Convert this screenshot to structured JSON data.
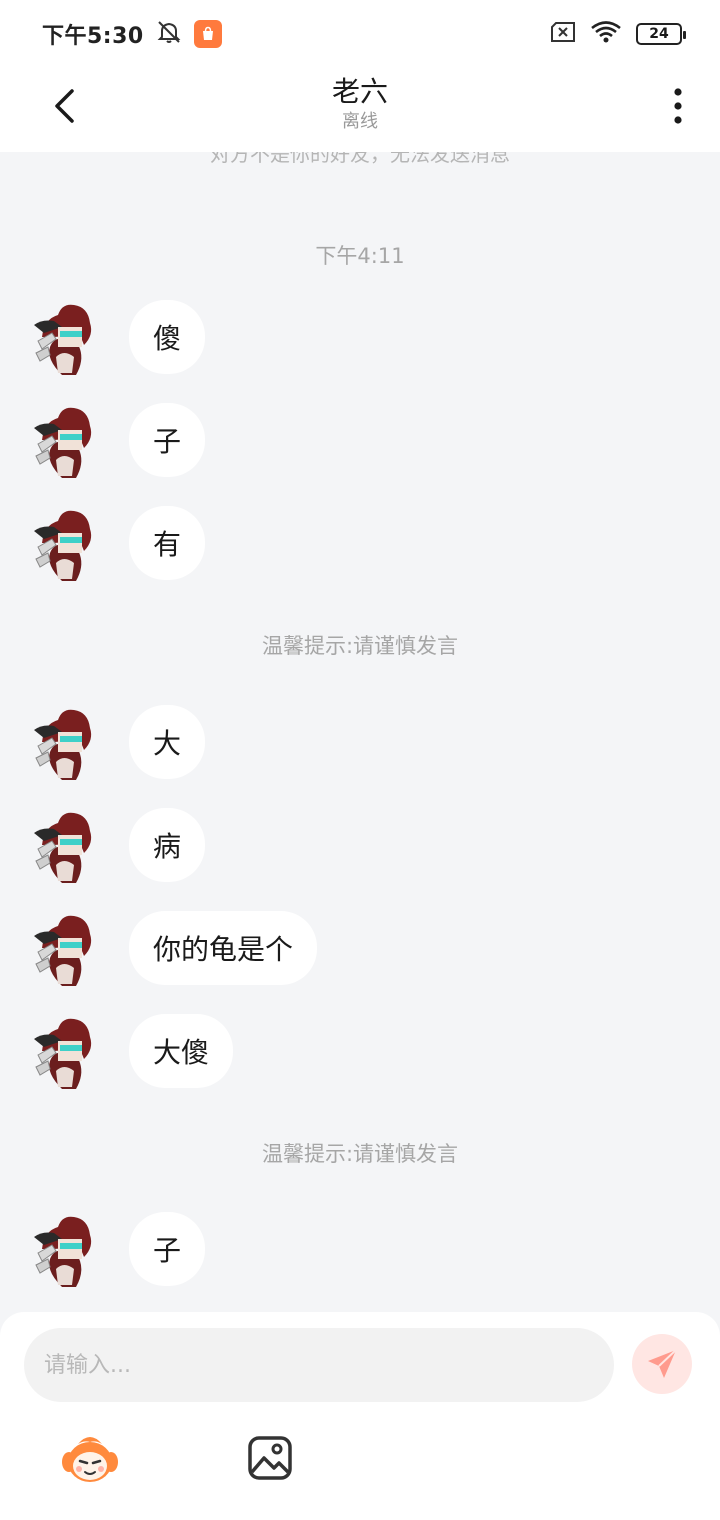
{
  "status_bar": {
    "time": "下午5:30",
    "battery": "24"
  },
  "header": {
    "title": "老六",
    "subtitle": "离线"
  },
  "chat": {
    "clipped_note": "对方不是你的好友，无法发送消息",
    "timestamp": "下午4:11",
    "tip_1": "温馨提示:请谨慎发言",
    "tip_2": "温馨提示:请谨慎发言",
    "messages": [
      {
        "text": "傻"
      },
      {
        "text": "子"
      },
      {
        "text": "有"
      },
      {
        "text": "大"
      },
      {
        "text": "病"
      },
      {
        "text": "你的龟是个"
      },
      {
        "text": "大傻"
      },
      {
        "text": "子"
      }
    ]
  },
  "composer": {
    "placeholder": "请输入...",
    "emoji_icon": "emoji-mascot-icon",
    "image_icon": "image-icon",
    "send_icon": "paper-plane-icon"
  },
  "colors": {
    "background": "#f4f5f7",
    "bubble": "#ffffff",
    "send_button": "#ffe6e3",
    "send_icon": "#ff9b8e",
    "app_badge": "#ff7a3d"
  }
}
